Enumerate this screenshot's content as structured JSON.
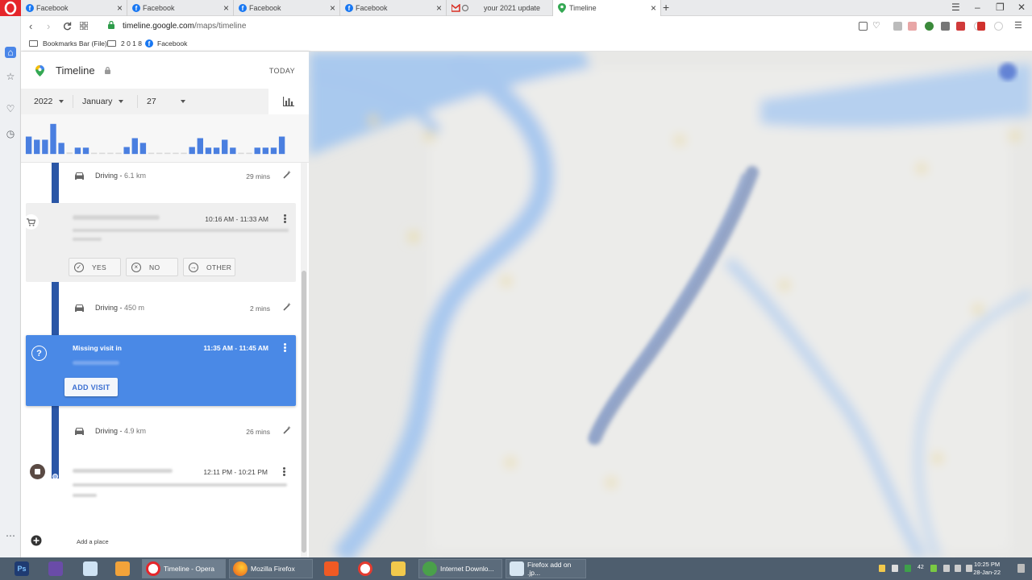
{
  "browser": {
    "tabs": [
      {
        "title": "Facebook",
        "favicon": "facebook-icon"
      },
      {
        "title": "Facebook",
        "favicon": "facebook-icon"
      },
      {
        "title": "Facebook",
        "favicon": "facebook-icon"
      },
      {
        "title": "Facebook",
        "favicon": "facebook-icon"
      },
      {
        "title": "your 2021 update",
        "favicon": "gmail-icon"
      },
      {
        "title": "Timeline",
        "favicon": "maps-pin-icon",
        "active": true
      }
    ],
    "url_host": "timeline.google.com",
    "url_path": "/maps/timeline",
    "bookmarks": {
      "bar_label": "Bookmarks Bar (File)",
      "folder_label": "2 0 1 8",
      "facebook_label": "Facebook"
    }
  },
  "timeline": {
    "title": "Timeline",
    "today_label": "TODAY",
    "year": "2022",
    "month": "January",
    "day": "27",
    "histogram": {
      "accent_color": "#4a7fe0",
      "light_color": "#d9d9d9",
      "days": [
        {
          "day": 1,
          "value": 0.55
        },
        {
          "day": 2,
          "value": 0.45
        },
        {
          "day": 3,
          "value": 0.45
        },
        {
          "day": 4,
          "value": 0.95
        },
        {
          "day": 5,
          "value": 0.35
        },
        {
          "day": 6,
          "value": 0.05
        },
        {
          "day": 7,
          "value": 0.2
        },
        {
          "day": 8,
          "value": 0.2
        },
        {
          "day": 9,
          "value": 0.04
        },
        {
          "day": 10,
          "value": 0.04
        },
        {
          "day": 11,
          "value": 0.04
        },
        {
          "day": 12,
          "value": 0.04
        },
        {
          "day": 13,
          "value": 0.22
        },
        {
          "day": 14,
          "value": 0.5
        },
        {
          "day": 15,
          "value": 0.35
        },
        {
          "day": 16,
          "value": 0.04
        },
        {
          "day": 17,
          "value": 0.04
        },
        {
          "day": 18,
          "value": 0.04
        },
        {
          "day": 19,
          "value": 0.04
        },
        {
          "day": 20,
          "value": 0.04
        },
        {
          "day": 21,
          "value": 0.22
        },
        {
          "day": 22,
          "value": 0.5
        },
        {
          "day": 23,
          "value": 0.2
        },
        {
          "day": 24,
          "value": 0.2
        },
        {
          "day": 25,
          "value": 0.45
        },
        {
          "day": 26,
          "value": 0.2
        },
        {
          "day": 27,
          "value": 0.04
        },
        {
          "day": 28,
          "value": 0.04
        },
        {
          "day": 29,
          "value": 0.2
        },
        {
          "day": 30,
          "value": 0.2
        },
        {
          "day": 31,
          "value": 0.2
        },
        {
          "day": 32,
          "value": 0.55
        }
      ]
    },
    "segments": {
      "drive1": {
        "label": "Driving",
        "distance": "6.1 km",
        "duration": "29 mins"
      },
      "visit": {
        "time": "10:16 AM - 11:33 AM",
        "yes": "YES",
        "no": "NO",
        "other": "OTHER"
      },
      "drive2": {
        "label": "Driving",
        "distance": "450 m",
        "duration": "2 mins"
      },
      "missing": {
        "label": "Missing visit in",
        "time": "11:35 AM - 11:45 AM",
        "action": "ADD VISIT"
      },
      "drive3": {
        "label": "Driving",
        "distance": "4.9 km",
        "duration": "26 mins"
      },
      "stay": {
        "time": "12:11 PM - 10:21 PM"
      }
    },
    "add_place_label": "Add a place"
  },
  "taskbar": {
    "items": [
      {
        "label": "",
        "icon": "photoshop-icon"
      },
      {
        "label": "",
        "icon": "visual-studio-icon"
      },
      {
        "label": "",
        "icon": "notepad-icon"
      },
      {
        "label": "",
        "icon": "media-player-icon"
      },
      {
        "label": "Timeline - Opera",
        "icon": "opera-icon"
      },
      {
        "label": "Mozilla Firefox",
        "icon": "firefox-icon"
      },
      {
        "label": "",
        "icon": "brave-icon"
      },
      {
        "label": "",
        "icon": "screen-recorder-icon"
      },
      {
        "label": "",
        "icon": "file-explorer-icon"
      },
      {
        "label": "Internet Downlo...",
        "icon": "idm-icon"
      },
      {
        "label": "Firefox add on .jp...",
        "icon": "paint-icon"
      }
    ],
    "tray_badge": "42",
    "time": "10:25 PM",
    "date": "28-Jan-22"
  }
}
